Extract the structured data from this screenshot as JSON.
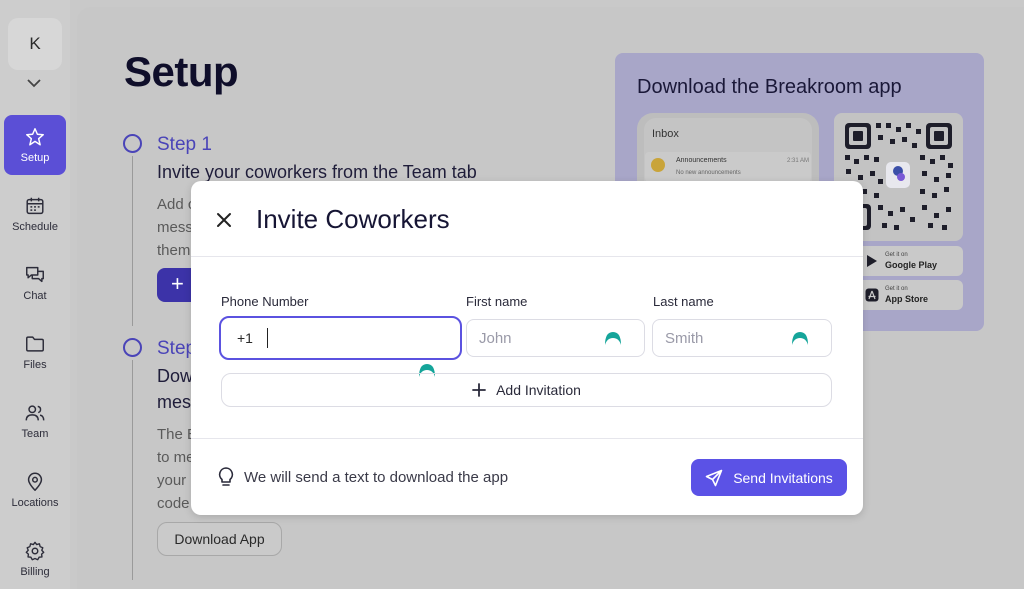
{
  "user": {
    "initial": "K"
  },
  "sidebar": {
    "items": [
      {
        "label": "Setup",
        "icon": "star-icon",
        "active": true
      },
      {
        "label": "Schedule",
        "icon": "calendar-icon"
      },
      {
        "label": "Chat",
        "icon": "chat-icon"
      },
      {
        "label": "Files",
        "icon": "folder-icon"
      },
      {
        "label": "Team",
        "icon": "team-icon"
      },
      {
        "label": "Locations",
        "icon": "location-pin-icon"
      },
      {
        "label": "Billing",
        "icon": "gear-icon"
      }
    ]
  },
  "page": {
    "title": "Setup",
    "step1": {
      "label": "Step 1",
      "heading": "Invite your coworkers from the Team tab",
      "text_lines": [
        "Add c",
        "mess",
        "them"
      ],
      "button_glyph": "+"
    },
    "step2": {
      "label": "Step",
      "heading_lines": [
        "Dow",
        "mes"
      ],
      "text_lines": [
        "The E",
        "to me",
        "your",
        "code"
      ],
      "download_button": "Download App"
    }
  },
  "promo": {
    "title": "Download the Breakroom app",
    "phone": {
      "header": "Inbox",
      "item_title": "Announcements",
      "item_sub": "No new announcements",
      "item_time": "2:31 AM"
    },
    "stores": [
      {
        "small": "Get it on",
        "big": "Google Play",
        "icon": "google-play-icon"
      },
      {
        "small": "Get it on",
        "big": "App Store",
        "icon": "app-store-icon"
      }
    ]
  },
  "modal": {
    "title": "Invite Coworkers",
    "fields": {
      "phone_label": "Phone Number",
      "phone_prefix": "+1",
      "phone_value": "",
      "first_label": "First name",
      "first_placeholder": "John",
      "last_label": "Last name",
      "last_placeholder": "Smith"
    },
    "add_label": "Add Invitation",
    "hint": "We will send a text to download the app",
    "send_label": "Send Invitations"
  },
  "colors": {
    "accent": "#5b52e6",
    "active_nav": "#5b4fd6",
    "grammarly": "#15a59a"
  }
}
